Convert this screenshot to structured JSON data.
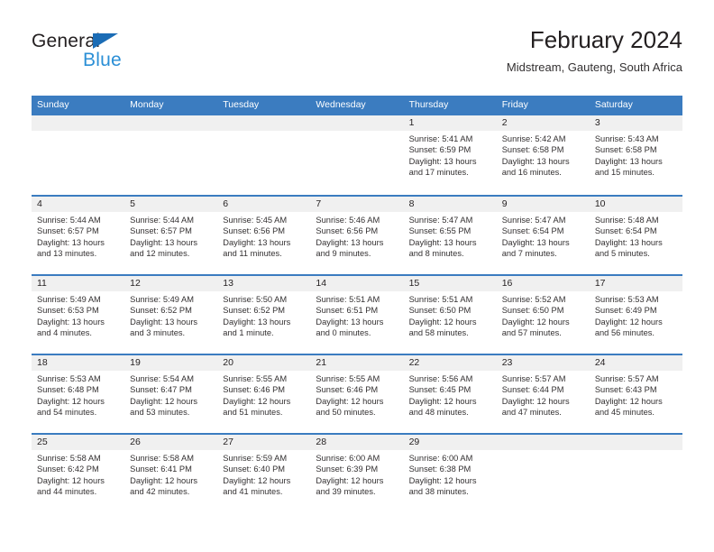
{
  "brand": {
    "name_part1": "General",
    "name_part2": "Blue",
    "triangle_color": "#1b6cb5",
    "blue_color": "#2b8fd6"
  },
  "header": {
    "title": "February 2024",
    "subtitle": "Midstream, Gauteng, South Africa"
  },
  "theme": {
    "header_blue": "#3b7cc0",
    "daynum_strip": "#f0f0f0",
    "text": "#333031"
  },
  "calendar": {
    "day_names": [
      "Sunday",
      "Monday",
      "Tuesday",
      "Wednesday",
      "Thursday",
      "Friday",
      "Saturday"
    ],
    "weeks": [
      [
        {
          "day": "",
          "sunrise": "",
          "sunset": "",
          "daylight": "",
          "empty": true
        },
        {
          "day": "",
          "sunrise": "",
          "sunset": "",
          "daylight": "",
          "empty": true
        },
        {
          "day": "",
          "sunrise": "",
          "sunset": "",
          "daylight": "",
          "empty": true
        },
        {
          "day": "",
          "sunrise": "",
          "sunset": "",
          "daylight": "",
          "empty": true
        },
        {
          "day": "1",
          "sunrise": "Sunrise: 5:41 AM",
          "sunset": "Sunset: 6:59 PM",
          "daylight": "Daylight: 13 hours and 17 minutes."
        },
        {
          "day": "2",
          "sunrise": "Sunrise: 5:42 AM",
          "sunset": "Sunset: 6:58 PM",
          "daylight": "Daylight: 13 hours and 16 minutes."
        },
        {
          "day": "3",
          "sunrise": "Sunrise: 5:43 AM",
          "sunset": "Sunset: 6:58 PM",
          "daylight": "Daylight: 13 hours and 15 minutes."
        }
      ],
      [
        {
          "day": "4",
          "sunrise": "Sunrise: 5:44 AM",
          "sunset": "Sunset: 6:57 PM",
          "daylight": "Daylight: 13 hours and 13 minutes."
        },
        {
          "day": "5",
          "sunrise": "Sunrise: 5:44 AM",
          "sunset": "Sunset: 6:57 PM",
          "daylight": "Daylight: 13 hours and 12 minutes."
        },
        {
          "day": "6",
          "sunrise": "Sunrise: 5:45 AM",
          "sunset": "Sunset: 6:56 PM",
          "daylight": "Daylight: 13 hours and 11 minutes."
        },
        {
          "day": "7",
          "sunrise": "Sunrise: 5:46 AM",
          "sunset": "Sunset: 6:56 PM",
          "daylight": "Daylight: 13 hours and 9 minutes."
        },
        {
          "day": "8",
          "sunrise": "Sunrise: 5:47 AM",
          "sunset": "Sunset: 6:55 PM",
          "daylight": "Daylight: 13 hours and 8 minutes."
        },
        {
          "day": "9",
          "sunrise": "Sunrise: 5:47 AM",
          "sunset": "Sunset: 6:54 PM",
          "daylight": "Daylight: 13 hours and 7 minutes."
        },
        {
          "day": "10",
          "sunrise": "Sunrise: 5:48 AM",
          "sunset": "Sunset: 6:54 PM",
          "daylight": "Daylight: 13 hours and 5 minutes."
        }
      ],
      [
        {
          "day": "11",
          "sunrise": "Sunrise: 5:49 AM",
          "sunset": "Sunset: 6:53 PM",
          "daylight": "Daylight: 13 hours and 4 minutes."
        },
        {
          "day": "12",
          "sunrise": "Sunrise: 5:49 AM",
          "sunset": "Sunset: 6:52 PM",
          "daylight": "Daylight: 13 hours and 3 minutes."
        },
        {
          "day": "13",
          "sunrise": "Sunrise: 5:50 AM",
          "sunset": "Sunset: 6:52 PM",
          "daylight": "Daylight: 13 hours and 1 minute."
        },
        {
          "day": "14",
          "sunrise": "Sunrise: 5:51 AM",
          "sunset": "Sunset: 6:51 PM",
          "daylight": "Daylight: 13 hours and 0 minutes."
        },
        {
          "day": "15",
          "sunrise": "Sunrise: 5:51 AM",
          "sunset": "Sunset: 6:50 PM",
          "daylight": "Daylight: 12 hours and 58 minutes."
        },
        {
          "day": "16",
          "sunrise": "Sunrise: 5:52 AM",
          "sunset": "Sunset: 6:50 PM",
          "daylight": "Daylight: 12 hours and 57 minutes."
        },
        {
          "day": "17",
          "sunrise": "Sunrise: 5:53 AM",
          "sunset": "Sunset: 6:49 PM",
          "daylight": "Daylight: 12 hours and 56 minutes."
        }
      ],
      [
        {
          "day": "18",
          "sunrise": "Sunrise: 5:53 AM",
          "sunset": "Sunset: 6:48 PM",
          "daylight": "Daylight: 12 hours and 54 minutes."
        },
        {
          "day": "19",
          "sunrise": "Sunrise: 5:54 AM",
          "sunset": "Sunset: 6:47 PM",
          "daylight": "Daylight: 12 hours and 53 minutes."
        },
        {
          "day": "20",
          "sunrise": "Sunrise: 5:55 AM",
          "sunset": "Sunset: 6:46 PM",
          "daylight": "Daylight: 12 hours and 51 minutes."
        },
        {
          "day": "21",
          "sunrise": "Sunrise: 5:55 AM",
          "sunset": "Sunset: 6:46 PM",
          "daylight": "Daylight: 12 hours and 50 minutes."
        },
        {
          "day": "22",
          "sunrise": "Sunrise: 5:56 AM",
          "sunset": "Sunset: 6:45 PM",
          "daylight": "Daylight: 12 hours and 48 minutes."
        },
        {
          "day": "23",
          "sunrise": "Sunrise: 5:57 AM",
          "sunset": "Sunset: 6:44 PM",
          "daylight": "Daylight: 12 hours and 47 minutes."
        },
        {
          "day": "24",
          "sunrise": "Sunrise: 5:57 AM",
          "sunset": "Sunset: 6:43 PM",
          "daylight": "Daylight: 12 hours and 45 minutes."
        }
      ],
      [
        {
          "day": "25",
          "sunrise": "Sunrise: 5:58 AM",
          "sunset": "Sunset: 6:42 PM",
          "daylight": "Daylight: 12 hours and 44 minutes."
        },
        {
          "day": "26",
          "sunrise": "Sunrise: 5:58 AM",
          "sunset": "Sunset: 6:41 PM",
          "daylight": "Daylight: 12 hours and 42 minutes."
        },
        {
          "day": "27",
          "sunrise": "Sunrise: 5:59 AM",
          "sunset": "Sunset: 6:40 PM",
          "daylight": "Daylight: 12 hours and 41 minutes."
        },
        {
          "day": "28",
          "sunrise": "Sunrise: 6:00 AM",
          "sunset": "Sunset: 6:39 PM",
          "daylight": "Daylight: 12 hours and 39 minutes."
        },
        {
          "day": "29",
          "sunrise": "Sunrise: 6:00 AM",
          "sunset": "Sunset: 6:38 PM",
          "daylight": "Daylight: 12 hours and 38 minutes."
        },
        {
          "day": "",
          "sunrise": "",
          "sunset": "",
          "daylight": "",
          "empty": true
        },
        {
          "day": "",
          "sunrise": "",
          "sunset": "",
          "daylight": "",
          "empty": true
        }
      ]
    ]
  }
}
